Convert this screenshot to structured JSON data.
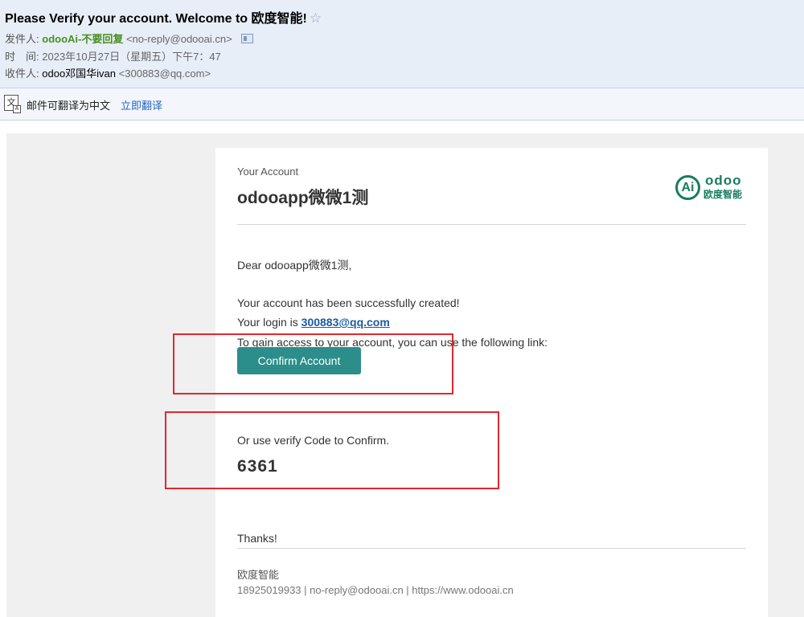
{
  "mail": {
    "subject": "Please Verify your account. Welcome to 欧度智能!",
    "star_icon": "☆",
    "from_label": "发件人:",
    "from_name": "odooAi-不要回复",
    "from_address": "<no-reply@odooai.cn>",
    "time_label": "时　间:",
    "time_value": "2023年10月27日（星期五）下午7：47",
    "to_label": "收件人:",
    "to_name": "odoo邓国华ivan",
    "to_address": "<300883@qq.com>",
    "translate_text": "邮件可翻译为中文",
    "translate_link": "立即翻译"
  },
  "email": {
    "account_label": "Your Account",
    "account_name": "odooapp微微1测",
    "logo_word": "odoo",
    "logo_mark": "Ai",
    "logo_cn": "欧度智能",
    "greeting": "Dear odooapp微微1测,",
    "created": "Your account has been successfully created!",
    "login_prefix": "Your login is ",
    "login_email": "300883@qq.com",
    "access_text": "To gain access to your account, you can use the following link:",
    "confirm_button": "Confirm Account",
    "verify_text": "Or use verify Code to Confirm.",
    "code": "6361",
    "thanks": "Thanks!",
    "footer_company": "欧度智能",
    "footer_info": "18925019933 | no-reply@odooai.cn | https://www.odooai.cn"
  },
  "colors": {
    "header_bg": "#e8eef8",
    "brand_green": "#187c60",
    "button_teal": "#2b8e8a",
    "highlight_red": "#e0282d",
    "link_blue": "#1a5aa3"
  }
}
